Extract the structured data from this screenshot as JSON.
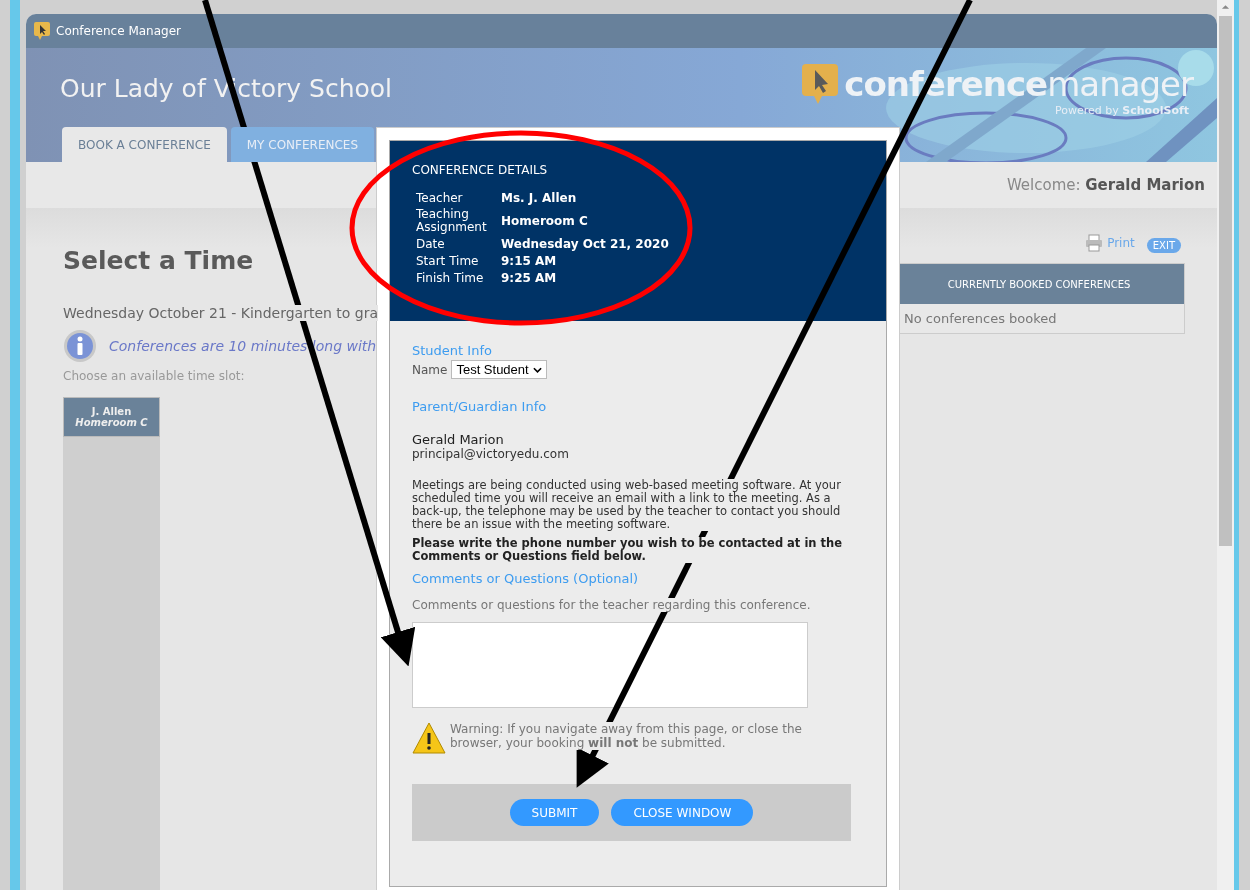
{
  "app_title": "Conference Manager",
  "school_name": "Our Lady of Victory School",
  "brand": {
    "name": "**conference**manager",
    "powered_by": "Powered by **SchoolSoft**"
  },
  "tabs": [
    {
      "label": "BOOK A CONFERENCE",
      "selected": true
    },
    {
      "label": "MY CONFERENCES",
      "selected": false
    }
  ],
  "welcome": {
    "label": "Welcome:",
    "name": "Gerald Marion"
  },
  "heading": "Select a Time",
  "date_line": "Wednesday October 21 - Kindergarten to gra",
  "info_note": "Conferences are 10 minutes long with",
  "slot_prompt": "Choose an available time slot:",
  "teacher_column": {
    "name": "J. Allen",
    "assignment": "Homeroom C"
  },
  "print_link": "Print",
  "exit_button": "EXIT",
  "booked": {
    "title": "CURRENTLY BOOKED CONFERENCES",
    "empty": "No conferences booked"
  },
  "dialog": {
    "title": "CONFERENCE DETAILS",
    "details": [
      {
        "label": "Teacher",
        "value": "Ms. J. Allen"
      },
      {
        "label": "Teaching Assignment",
        "value": "Homeroom C"
      },
      {
        "label": "Date",
        "value": "Wednesday Oct 21, 2020"
      },
      {
        "label": "Start Time",
        "value": "9:15 AM"
      },
      {
        "label": "Finish Time",
        "value": "9:25 AM"
      }
    ],
    "student_heading": "Student Info",
    "name_label": "Name",
    "student_value": "Test Student",
    "parent_heading": "Parent/Guardian Info",
    "parent_name": "Gerald Marion",
    "parent_email": "principal@victoryedu.com",
    "meeting_note": "Meetings are being conducted using web-based meeting software. At your scheduled time you will receive an email with a link to the meeting. As a back-up, the telephone may be used by the teacher to contact you should there be an issue with the meeting software.",
    "phone_note": "Please write the phone number you wish to be contacted at in the Comments or Questions field below.",
    "comments_heading": "Comments or Questions (Optional)",
    "comments_hint": "Comments or questions for the teacher regarding this conference.",
    "warning": "Warning: If you navigate away from this page, or close the browser, your booking **will not** be submitted.",
    "buttons": [
      "SUBMIT",
      "CLOSE WINDOW"
    ]
  }
}
